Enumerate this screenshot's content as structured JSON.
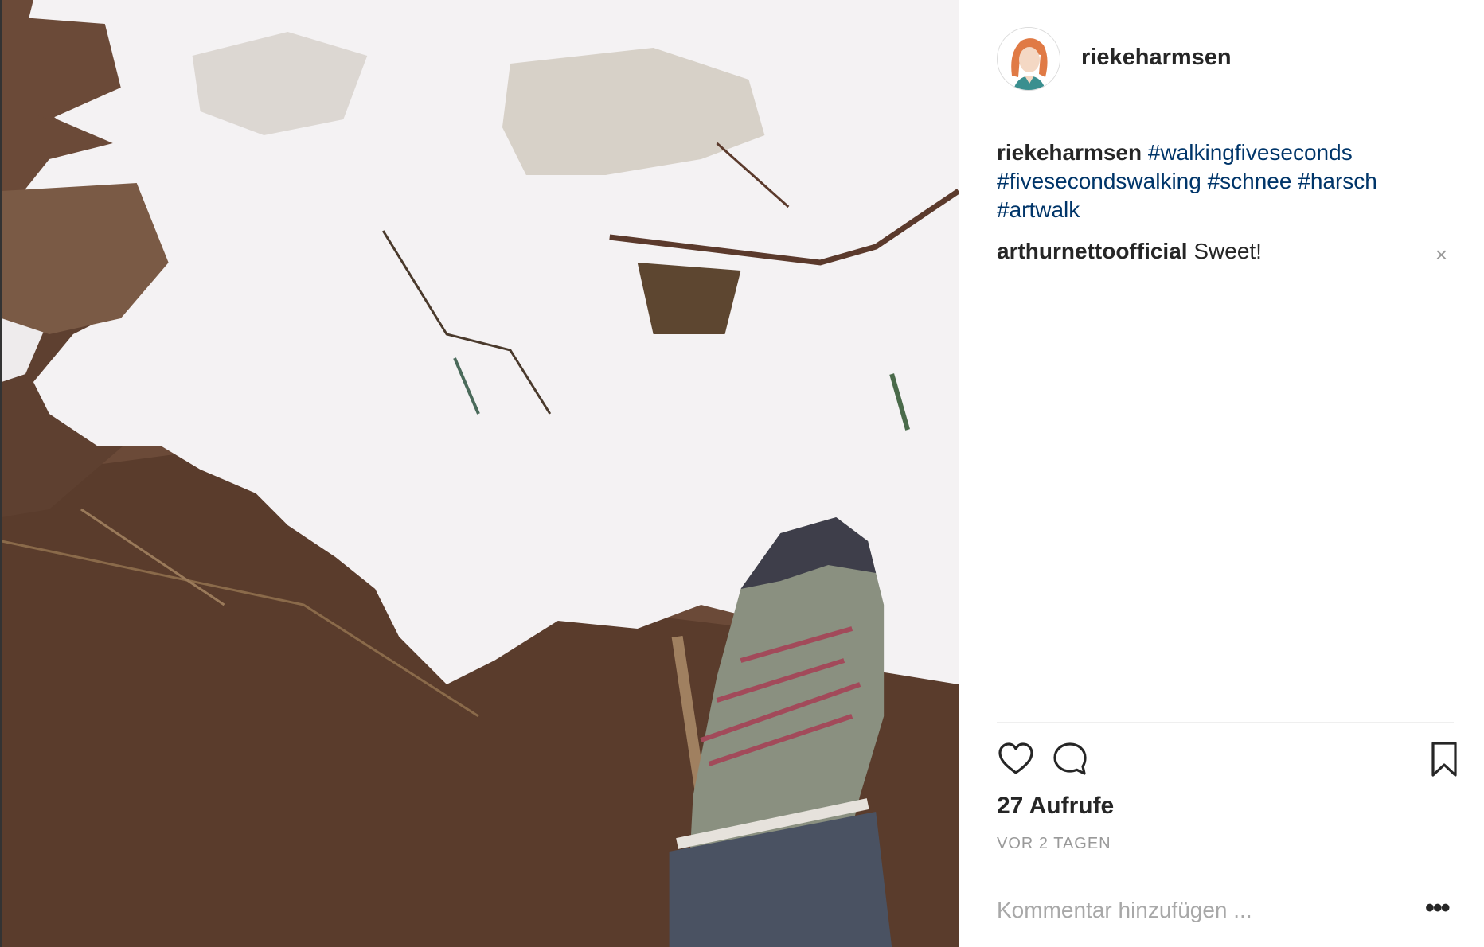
{
  "post": {
    "author": "riekeharmsen",
    "caption_user": "riekeharmsen",
    "hashtags": [
      "#walkingfiveseconds",
      "#fivesecondswalking",
      "#schnee",
      "#harsch",
      "#artwalk"
    ],
    "comment": {
      "user": "arthurnettoofficial",
      "text": "Sweet!",
      "delete_symbol": "×"
    },
    "views": "27 Aufrufe",
    "time": "VOR 2 TAGEN",
    "comment_placeholder": "Kommentar hinzufügen ...",
    "more_symbol": "•••"
  },
  "icons": {
    "like": "heart-icon",
    "comment": "speech-bubble-icon",
    "save": "bookmark-icon",
    "avatar": "profile-illustration"
  },
  "colors": {
    "hashtag": "#003569",
    "muted": "#999999",
    "text": "#262626"
  }
}
